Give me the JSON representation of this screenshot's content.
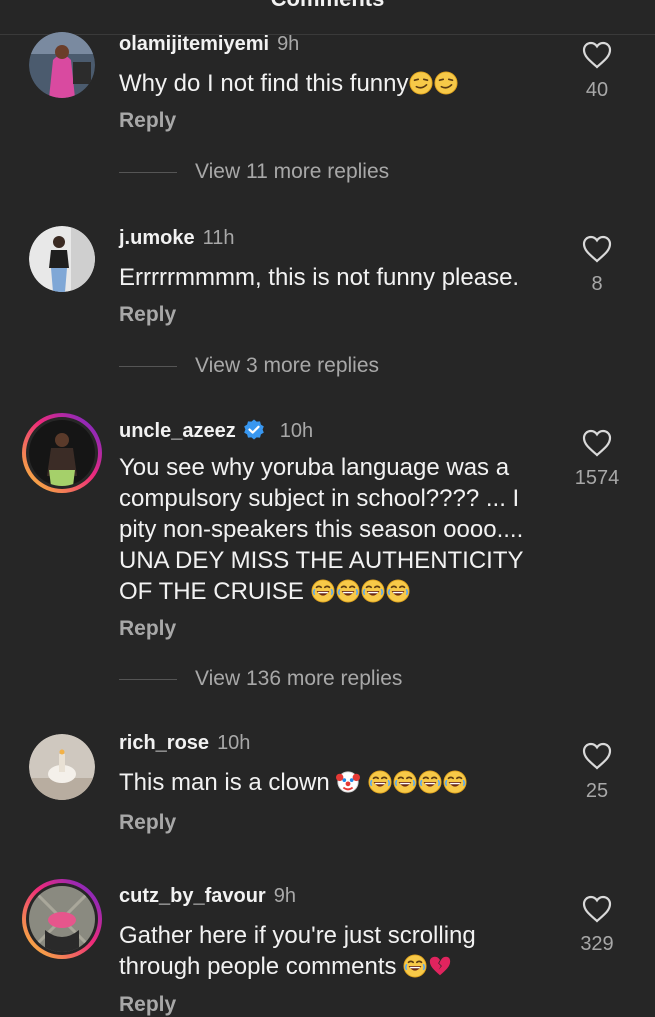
{
  "header": {
    "title": "Comments"
  },
  "comments": [
    {
      "username": "olamijitemiyemi",
      "time": "9h",
      "text": "Why do I not find this funny",
      "emoji": [
        "smirk",
        "smirk"
      ],
      "likes": "40",
      "reply_label": "Reply",
      "view_more": "View 11 more replies",
      "verified": false
    },
    {
      "username": "j.umoke",
      "time": "11h",
      "text": "Errrrrmmmm, this is not funny please.",
      "emoji": [],
      "likes": "8",
      "reply_label": "Reply",
      "view_more": "View 3 more replies",
      "verified": false
    },
    {
      "username": "uncle_azeez",
      "time": "10h",
      "text_lines": [
        "You see why yoruba language was a",
        "compulsory subject in school???? ... I",
        "pity non-speakers this season oooo....",
        "UNA DEY MISS THE AUTHENTICITY",
        "OF THE CRUISE"
      ],
      "emoji": [
        "laugh",
        "laugh",
        "laugh",
        "laugh"
      ],
      "likes": "1574",
      "reply_label": "Reply",
      "view_more": "View 136 more replies",
      "verified": true
    },
    {
      "username": "rich_rose",
      "time": "10h",
      "text": "This man is a clown",
      "emoji": [
        "clown",
        "laugh",
        "laugh",
        "laugh",
        "laugh"
      ],
      "likes": "25",
      "reply_label": "Reply",
      "verified": false
    },
    {
      "username": "cutz_by_favour",
      "time": "9h",
      "text_lines": [
        "Gather here if you're just scrolling",
        "through people comments"
      ],
      "emoji": [
        "laugh",
        "broken-heart"
      ],
      "likes": "329",
      "reply_label": "Reply",
      "verified": false
    }
  ],
  "colors": {
    "background": "#262626",
    "text": "#f2f2f2",
    "secondary": "#a8a8a8",
    "verified": "#3897f0"
  }
}
